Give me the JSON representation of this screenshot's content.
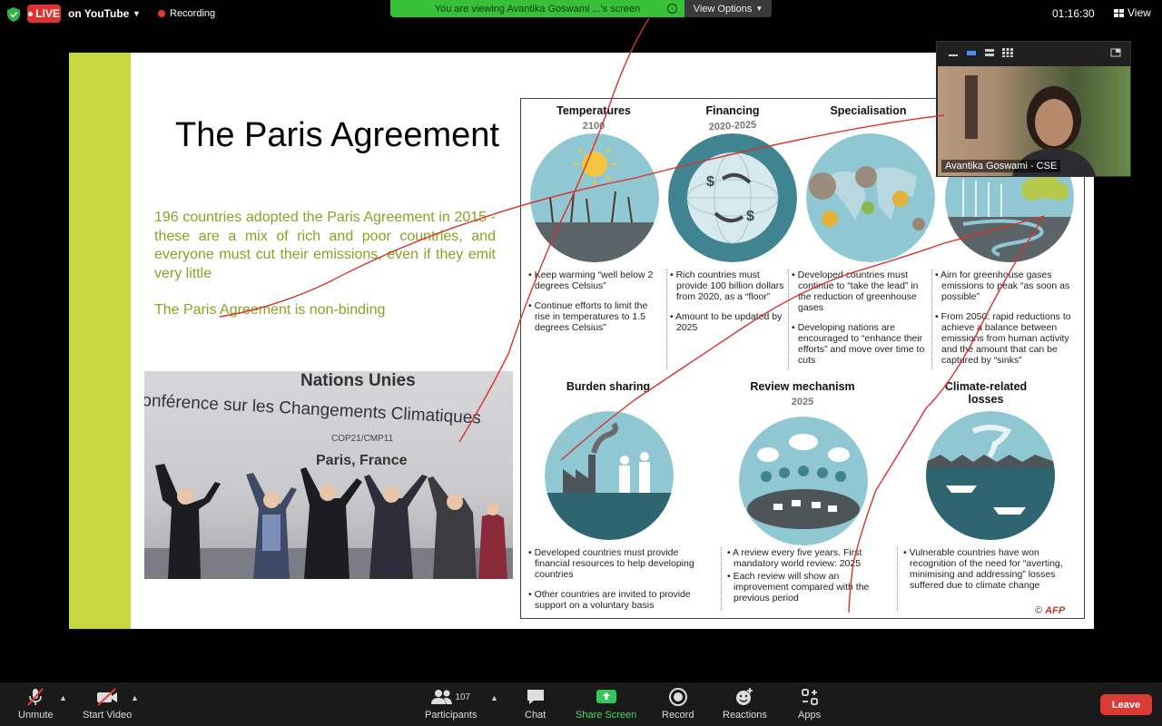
{
  "topbar": {
    "live_label": "LIVE",
    "stream_label": "on YouTube",
    "recording_label": "Recording",
    "viewing_banner": "You are viewing Avantika Goswami ...'s screen",
    "view_options_label": "View Options",
    "timer": "01:16:30",
    "view_label": "View"
  },
  "slide": {
    "title": "The Paris Agreement",
    "body": "196 countries adopted the Paris Agreement in 2015 - these are a mix of rich and poor countries, and everyone must cut their emissions, even if they emit very little",
    "note": "The Paris Agreement is non-binding",
    "photo": {
      "line1": "Nations Unies",
      "line2": "onférence sur les Changements Climatiques",
      "line3": "COP21/CMP11",
      "line4": "Paris, France"
    },
    "infographic": {
      "sections": [
        {
          "title": "Temperatures",
          "subtitle": "2100",
          "bullets": [
            "Keep warming “well below 2 degrees Celsius”",
            "Continue efforts to limit the rise in temperatures to 1.5 degrees Celsius”"
          ]
        },
        {
          "title": "Financing",
          "subtitle": "2020-2025",
          "bullets": [
            "Rich countries must provide 100 billion dollars from 2020, as a “floor”",
            "Amount to be updated by 2025"
          ]
        },
        {
          "title": "Specialisation",
          "subtitle": "",
          "bullets": [
            "Developed countries must continue to “take the lead” in the reduction of greenhouse gases",
            "Developing nations are encouraged to “enhance their efforts” and move over time to cuts"
          ]
        },
        {
          "title": "",
          "subtitle": "",
          "bullets": [
            "Aim for greenhouse gases emissions to peak “as soon as possible”",
            "From 2050: rapid reductions to achieve a balance between emissions from human activity and the amount that can be captured by “sinks”"
          ]
        },
        {
          "title": "Burden sharing",
          "subtitle": "",
          "bullets": [
            "Developed countries must provide financial resources to help developing countries",
            "Other countries are invited to provide support on a voluntary basis"
          ]
        },
        {
          "title": "Review mechanism",
          "subtitle": "2025",
          "bullets": [
            "A review every five years. First mandatory world review: 2025",
            "Each review will show an improvement compared with the previous period"
          ]
        },
        {
          "title": "Climate-related losses",
          "subtitle": "",
          "bullets": [
            "Vulnerable countries have won recognition of the need for “averting, minimising and addressing” losses suffered due to climate change"
          ]
        }
      ],
      "credit_symbol": "©",
      "credit": "AFP"
    }
  },
  "participant": {
    "name": "Avantika Goswami - CSE"
  },
  "toolbar": {
    "unmute": "Unmute",
    "start_video": "Start Video",
    "participants": "Participants",
    "participants_count": "107",
    "chat": "Chat",
    "share_screen": "Share Screen",
    "record": "Record",
    "reactions": "Reactions",
    "apps": "Apps",
    "leave": "Leave"
  },
  "colors": {
    "live": "#e0312f",
    "banner": "#38c138",
    "slide_accent": "#c8d83f",
    "slide_text": "#8da023",
    "leave": "#d93a36",
    "annotation": "#d9322b"
  }
}
